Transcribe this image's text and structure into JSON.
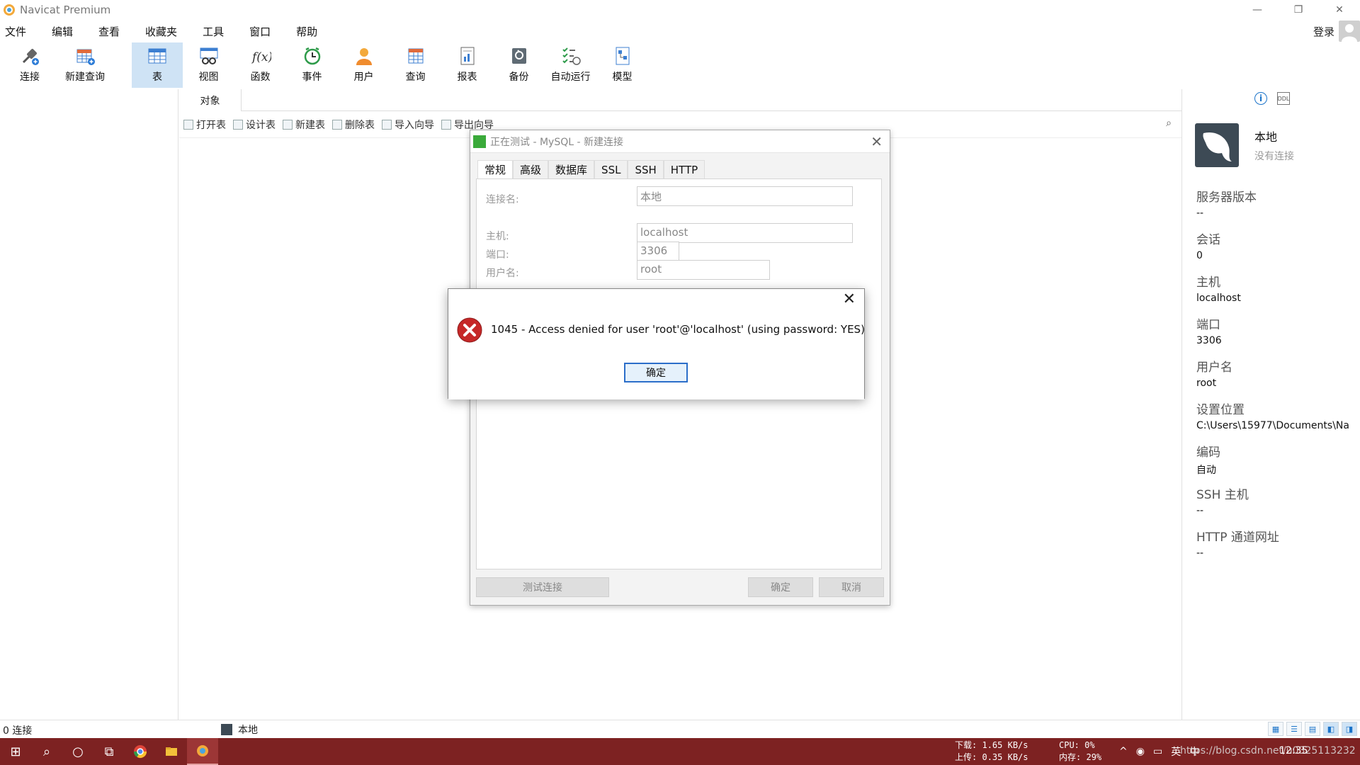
{
  "app": {
    "title": "Navicat Premium"
  },
  "menu": [
    "文件",
    "编辑",
    "查看",
    "收藏夹",
    "工具",
    "窗口",
    "帮助"
  ],
  "login_label": "登录",
  "toolbar": [
    {
      "label": "连接",
      "icon": "plug-icon"
    },
    {
      "label": "新建查询",
      "icon": "new-query-icon"
    },
    {
      "label": "表",
      "icon": "table-icon",
      "active": true
    },
    {
      "label": "视图",
      "icon": "view-icon"
    },
    {
      "label": "函数",
      "icon": "function-icon"
    },
    {
      "label": "事件",
      "icon": "event-clock-icon"
    },
    {
      "label": "用户",
      "icon": "user-icon"
    },
    {
      "label": "查询",
      "icon": "query-icon"
    },
    {
      "label": "报表",
      "icon": "report-icon"
    },
    {
      "label": "备份",
      "icon": "backup-icon"
    },
    {
      "label": "自动运行",
      "icon": "auto-run-icon"
    },
    {
      "label": "模型",
      "icon": "model-icon"
    }
  ],
  "objects": {
    "tab": "对象",
    "actions": [
      "打开表",
      "设计表",
      "新建表",
      "删除表",
      "导入向导",
      "导出向导"
    ],
    "search_icon": "search-icon"
  },
  "info": {
    "conn_name": "本地",
    "conn_status": "没有连接",
    "rows": [
      {
        "label": "服务器版本",
        "value": "--"
      },
      {
        "label": "会话",
        "value": "0"
      },
      {
        "label": "主机",
        "value": "localhost"
      },
      {
        "label": "端口",
        "value": "3306"
      },
      {
        "label": "用户名",
        "value": "root"
      },
      {
        "label": "设置位置",
        "value": "C:\\Users\\15977\\Documents\\Na"
      },
      {
        "label": "编码",
        "value": "自动"
      },
      {
        "label": "SSH 主机",
        "value": "--"
      },
      {
        "label": "HTTP 通道网址",
        "value": "--"
      }
    ]
  },
  "status": {
    "connections": "0 连接",
    "current": "本地"
  },
  "conn_dialog": {
    "title": "正在测试 - MySQL - 新建连接",
    "tabs": [
      "常规",
      "高级",
      "数据库",
      "SSL",
      "SSH",
      "HTTP"
    ],
    "fields": {
      "name_label": "连接名:",
      "name_value": "本地",
      "host_label": "主机:",
      "host_value": "localhost",
      "port_label": "端口:",
      "port_value": "3306",
      "user_label": "用户名:",
      "user_value": "root"
    },
    "buttons": {
      "test": "测试连接",
      "ok": "确定",
      "cancel": "取消"
    }
  },
  "error": {
    "message": "1045 - Access denied for user 'root'@'localhost' (using password: YES)",
    "ok": "确定"
  },
  "taskbar": {
    "down_label": "下载:",
    "down_value": "1.65 KB/s",
    "up_label": "上传:",
    "up_value": "0.35 KB/s",
    "cpu_label": "CPU:",
    "cpu_value": "0%",
    "mem_label": "内存:",
    "mem_value": "29%",
    "tray": [
      "^",
      "英",
      "中"
    ],
    "clock": "12:35",
    "watermark": "https://blog.csdn.net/u0325113232"
  },
  "colors": {
    "taskbar": "#7d2222",
    "active_tool": "#cfe3f5",
    "accent": "#2b6ec9",
    "error_red": "#c62828"
  }
}
